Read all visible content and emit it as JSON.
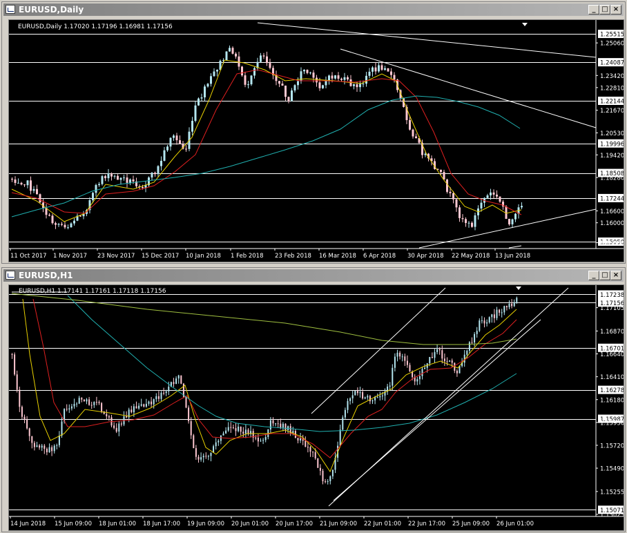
{
  "colors": {
    "background": "#000000",
    "foreground": "#ffffff",
    "bull_candle": "#b4e6f0",
    "bear_candle": "#ffc8d2",
    "ma_fast": "#e8d000",
    "ma_mid": "#e02020",
    "ma_slow": "#20b0b0",
    "ma_200": "#a0c040",
    "line_tool": "#ffffff"
  },
  "daily_window": {
    "title": "EURUSD,Daily",
    "info": "EURUSD,Daily  1.17020 1.17196 1.16981 1.17156",
    "price_labels": [
      "1.25515",
      "1.25060",
      "1.24087",
      "1.23420",
      "1.22810",
      "1.22144",
      "1.21670",
      "1.20530",
      "1.19996",
      "1.19420",
      "1.18508",
      "1.18280",
      "1.17244",
      "1.16600",
      "1.16000",
      "1.15050",
      "1.15000"
    ],
    "boxed_levels": [
      "1.25515",
      "1.24087",
      "1.22144",
      "1.19996",
      "1.18508",
      "1.17244",
      "1.15050"
    ],
    "time_labels": [
      "11 Oct 2017",
      "1 Nov 2017",
      "23 Nov 2017",
      "15 Dec 2017",
      "10 Jan 2018",
      "1 Feb 2018",
      "23 Feb 2018",
      "16 Mar 2018",
      "6 Apr 2018",
      "30 Apr 2018",
      "22 May 2018",
      "13 Jun 2018"
    ]
  },
  "h1_window": {
    "title": "EURUSD,H1",
    "info": "EURUSD,H1  1.17141 1.17161 1.17118 1.17156",
    "price_labels": [
      "1.17238",
      "1.17156",
      "1.17105",
      "1.16870",
      "1.16701",
      "1.16640",
      "1.16410",
      "1.16278",
      "1.16180",
      "1.15987",
      "1.15950",
      "1.15720",
      "1.15490",
      "1.15255",
      "1.15071",
      "1.15025"
    ],
    "boxed_levels": [
      "1.17238",
      "1.17156",
      "1.16701",
      "1.16278",
      "1.15987",
      "1.15071"
    ],
    "time_labels": [
      "14 Jun 2018",
      "15 Jun 09:00",
      "18 Jun 01:00",
      "18 Jun 17:00",
      "19 Jun 09:00",
      "20 Jun 01:00",
      "20 Jun 17:00",
      "21 Jun 09:00",
      "22 Jun 01:00",
      "22 Jun 17:00",
      "25 Jun 09:00",
      "26 Jun 01:00"
    ]
  }
}
